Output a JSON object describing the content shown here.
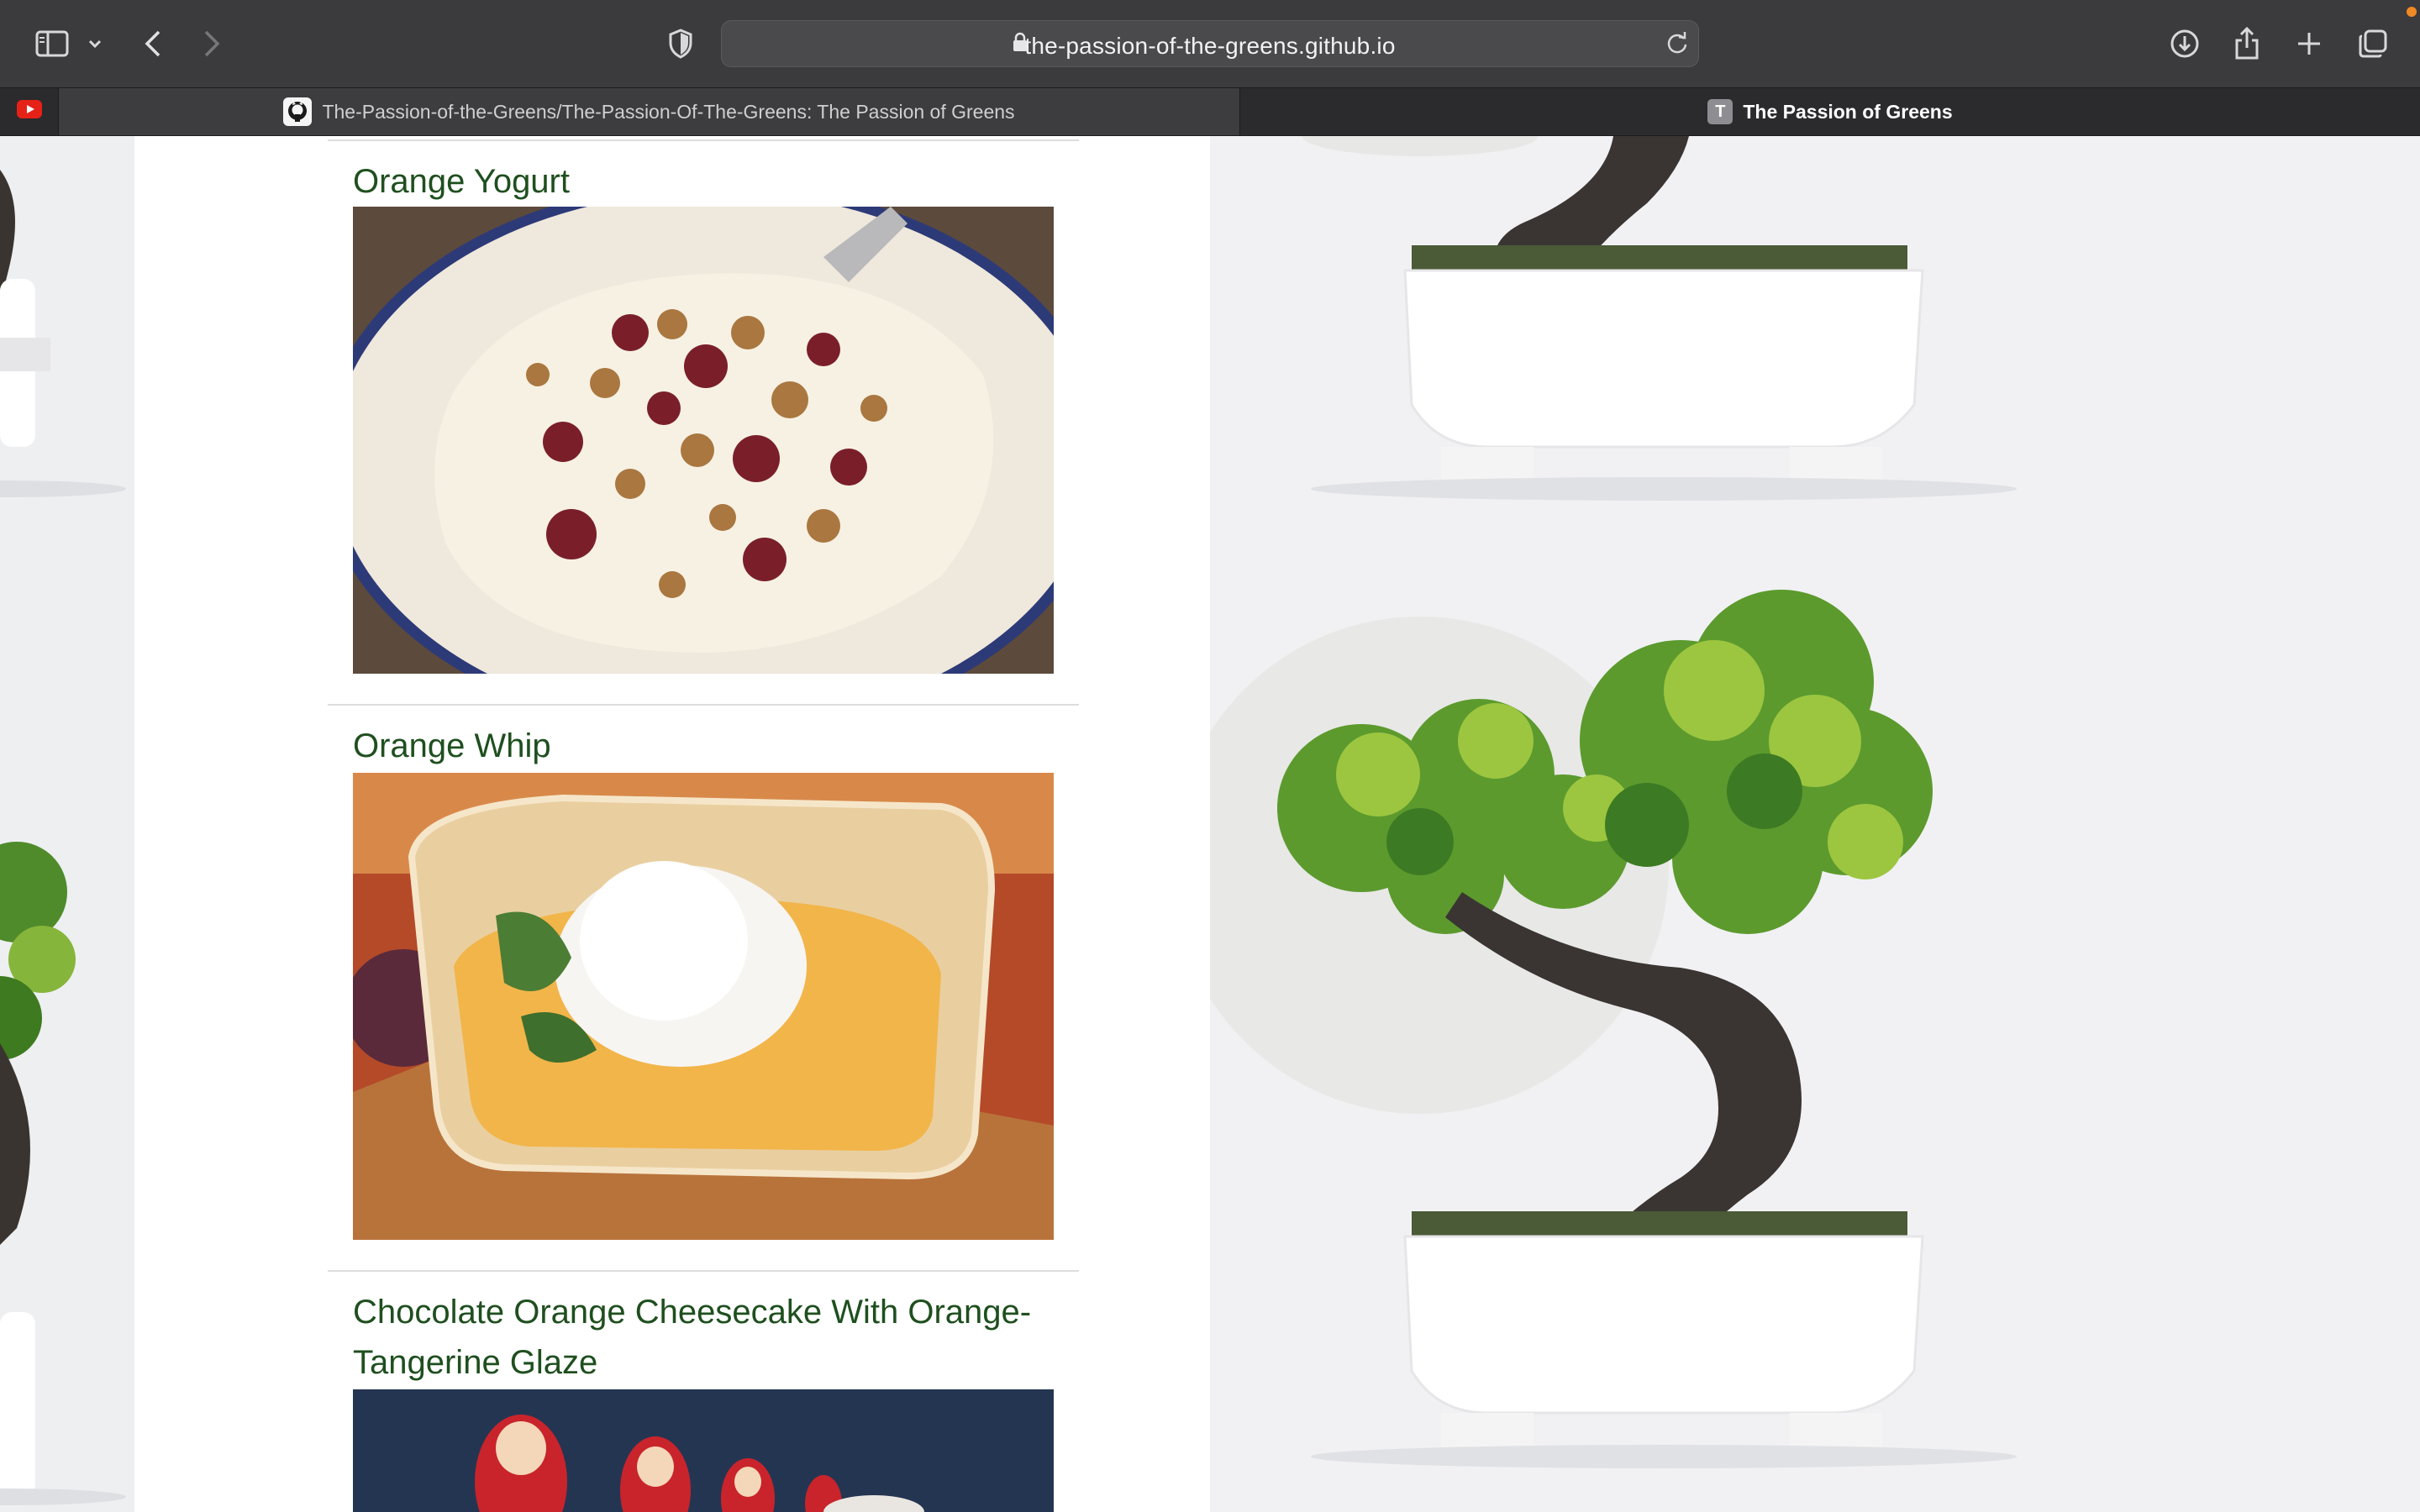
{
  "browser": {
    "url": "the-passion-of-the-greens.github.io",
    "tabs": [
      {
        "label": "The-Passion-of-the-Greens/The-Passion-Of-The-Greens: The Passion of Greens",
        "icon": "github-icon",
        "active": false
      },
      {
        "label": "The Passion of Greens",
        "icon": "site-letter-icon",
        "icon_letter": "T",
        "active": true
      }
    ],
    "pinned_tab_icon": "youtube-icon"
  },
  "recipes": [
    {
      "title": "Orange Yogurt",
      "image": "orange-yogurt-photo"
    },
    {
      "title": "Orange Whip",
      "image": "orange-whip-photo"
    },
    {
      "title": "Chocolate Orange Cheesecake With Orange-Tangerine Glaze",
      "image": "chocolate-orange-cheesecake-photo"
    }
  ],
  "colors": {
    "title_green": "#1f4f1f",
    "chrome_dark": "#3b3a3d",
    "tabbar_dark": "#2b2a2d"
  }
}
